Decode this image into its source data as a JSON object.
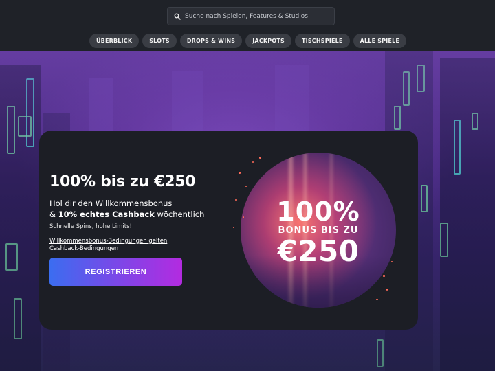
{
  "header": {
    "search": {
      "placeholder": "Suche nach Spielen, Features & Studios",
      "icon": "search-icon"
    },
    "tabs": [
      {
        "label": "ÜBERBLICK"
      },
      {
        "label": "SLOTS"
      },
      {
        "label": "DROPS & WINS"
      },
      {
        "label": "JACKPOTS"
      },
      {
        "label": "TISCHSPIELE"
      },
      {
        "label": "ALLE SPIELE"
      }
    ]
  },
  "promo": {
    "headline": "100% bis zu €250",
    "subtitle_line1": "Hol dir den Willkommensbonus",
    "subtitle_prefix": "& ",
    "subtitle_bold": "10% echtes Cashback",
    "subtitle_suffix": " wöchentlich",
    "note": "Schnelle Spins, hohe Limits!",
    "link_terms": "Willkommensbonus-Bedingungen gelten",
    "link_cashback": "Cashback-Bedingungen",
    "cta_label": "REGISTRIEREN",
    "badge": {
      "line1": "100%",
      "line2": "BONUS BIS ZU",
      "line3": "€250"
    }
  },
  "colors": {
    "header_bg": "#1f2228",
    "tab_bg": "#3a3d44",
    "card_bg": "#1c1e25",
    "cta_gradient_start": "#3b6df0",
    "cta_gradient_end": "#b32be0",
    "hero_purple": "#5b3694"
  }
}
